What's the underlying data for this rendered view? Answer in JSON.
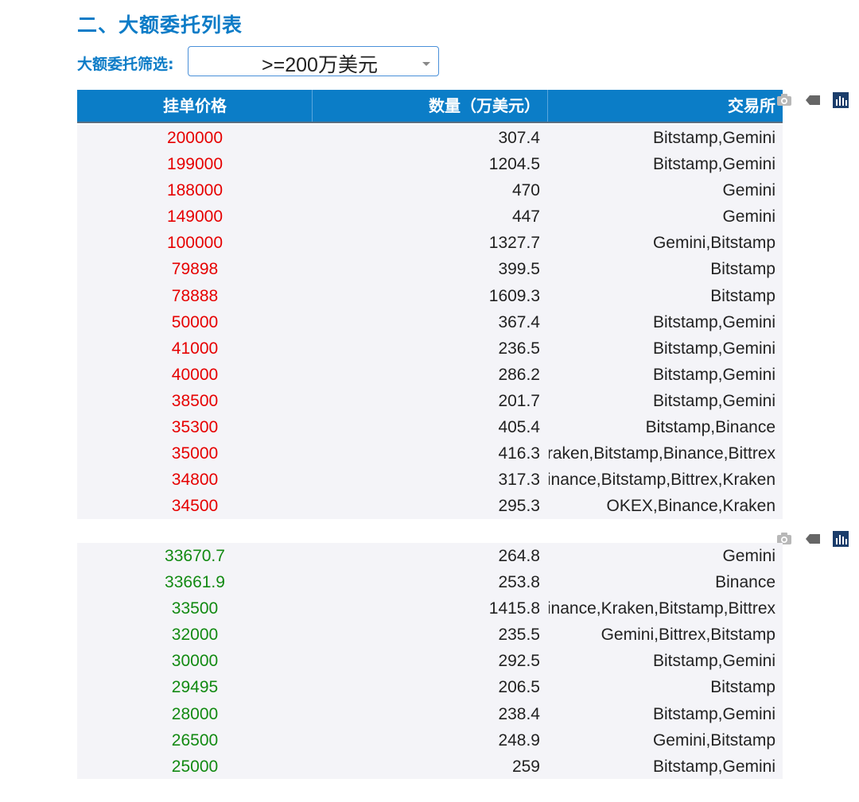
{
  "title": "二、大额委托列表",
  "filter": {
    "label": "大额委托筛选:",
    "selected": ">=200万美元"
  },
  "columns": [
    "挂单价格",
    "数量（万美元）",
    "交易所"
  ],
  "colors": {
    "accent": "#0d7cc7",
    "header_bg": "#0b7dc7",
    "ask": "#e60000",
    "bid": "#128a12"
  },
  "icons": [
    "camera-icon",
    "tag-icon",
    "bar-chart-icon"
  ],
  "asks": [
    {
      "price": "200000",
      "qty": "307.4",
      "exchange": "Bitstamp,Gemini"
    },
    {
      "price": "199000",
      "qty": "1204.5",
      "exchange": "Bitstamp,Gemini"
    },
    {
      "price": "188000",
      "qty": "470",
      "exchange": "Gemini"
    },
    {
      "price": "149000",
      "qty": "447",
      "exchange": "Gemini"
    },
    {
      "price": "100000",
      "qty": "1327.7",
      "exchange": "Gemini,Bitstamp"
    },
    {
      "price": "79898",
      "qty": "399.5",
      "exchange": "Bitstamp"
    },
    {
      "price": "78888",
      "qty": "1609.3",
      "exchange": "Bitstamp"
    },
    {
      "price": "50000",
      "qty": "367.4",
      "exchange": "Bitstamp,Gemini"
    },
    {
      "price": "41000",
      "qty": "236.5",
      "exchange": "Bitstamp,Gemini"
    },
    {
      "price": "40000",
      "qty": "286.2",
      "exchange": "Bitstamp,Gemini"
    },
    {
      "price": "38500",
      "qty": "201.7",
      "exchange": "Bitstamp,Gemini"
    },
    {
      "price": "35300",
      "qty": "405.4",
      "exchange": "Bitstamp,Binance"
    },
    {
      "price": "35000",
      "qty": "416.3",
      "exchange": "Kraken,Bitstamp,Binance,Bittrex"
    },
    {
      "price": "34800",
      "qty": "317.3",
      "exchange": "Binance,Bitstamp,Bittrex,Kraken"
    },
    {
      "price": "34500",
      "qty": "295.3",
      "exchange": "OKEX,Binance,Kraken"
    }
  ],
  "bids": [
    {
      "price": "33670.7",
      "qty": "264.8",
      "exchange": "Gemini"
    },
    {
      "price": "33661.9",
      "qty": "253.8",
      "exchange": "Binance"
    },
    {
      "price": "33500",
      "qty": "1415.8",
      "exchange": "Binance,Kraken,Bitstamp,Bittrex"
    },
    {
      "price": "32000",
      "qty": "235.5",
      "exchange": "Gemini,Bittrex,Bitstamp"
    },
    {
      "price": "30000",
      "qty": "292.5",
      "exchange": "Bitstamp,Gemini"
    },
    {
      "price": "29495",
      "qty": "206.5",
      "exchange": "Bitstamp"
    },
    {
      "price": "28000",
      "qty": "238.4",
      "exchange": "Bitstamp,Gemini"
    },
    {
      "price": "26500",
      "qty": "248.9",
      "exchange": "Gemini,Bitstamp"
    },
    {
      "price": "25000",
      "qty": "259",
      "exchange": "Bitstamp,Gemini"
    }
  ]
}
